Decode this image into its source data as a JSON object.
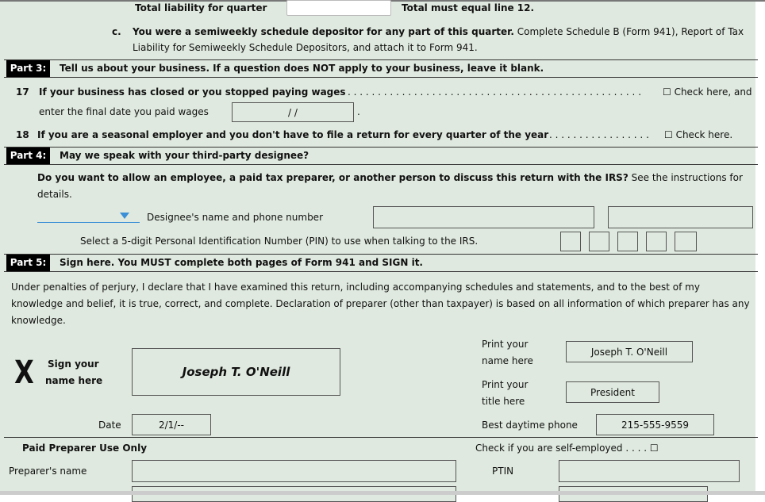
{
  "line16": {
    "total_label": "Total liability for quarter",
    "total_value": "",
    "total_note": "Total must equal line 12.",
    "c_letter": "c.",
    "c_bold": "You were a semiweekly schedule depositor for any part of this quarter.",
    "c_rest": "Complete Schedule B (Form 941), Report of Tax",
    "c_line2": "Liability for Semiweekly Schedule Depositors, and attach it to Form 941."
  },
  "part3": {
    "label": "Part 3:",
    "title": "Tell us about your business. If a question does NOT apply to your business, leave it blank.",
    "q17_num": "17",
    "q17_text": "If your business has closed or you stopped paying wages",
    "q17_dots": ". . . . . . . . . . . . . . . . . . . . . . . . . . . . . . . . . . . . . . . . . . . . . . . . .",
    "q17_check": "☐ Check here, and",
    "q17_line2": "enter the final date you paid wages",
    "q17_date": "/        /",
    "q17_period": ".",
    "q18_num": "18",
    "q18_text": "If you are a seasonal employer and you don't have to file a return for every quarter of the year",
    "q18_dots": ". . . . . . . . . . . . . . . . .",
    "q18_check": "☐ Check here."
  },
  "part4": {
    "label": "Part 4:",
    "title": "May we speak with your third-party designee?",
    "question_bold": "Do you want to allow an employee, a paid tax preparer, or another person to discuss this return with the IRS?",
    "question_rest": "See the instructions for",
    "question_line2": "details.",
    "dropdown_value": "",
    "designee_label": "Designee's name and phone number",
    "designee_name": "",
    "designee_phone": "",
    "pin_label": "Select a 5-digit Personal Identification Number (PIN) to use when talking to the IRS.",
    "pin_digits": [
      "",
      "",
      "",
      "",
      ""
    ]
  },
  "part5": {
    "label": "Part 5:",
    "title": "Sign here. You MUST complete both pages of Form 941 and SIGN it.",
    "declaration": [
      "Under penalties of perjury, I declare that I have examined this return, including accompanying schedules and statements, and to the best of my",
      "knowledge and belief, it is true, correct, and complete. Declaration of preparer (other than taxpayer) is based on all information of which preparer has any",
      "knowledge."
    ],
    "x_mark": "X",
    "sign_label_1": "Sign your",
    "sign_label_2": "name here",
    "signature": "Joseph T. O'Neill",
    "print_name_label_1": "Print your",
    "print_name_label_2": "name here",
    "print_name": "Joseph T. O'Neill",
    "print_title_label_1": "Print your",
    "print_title_label_2": "title here",
    "print_title": "President",
    "date_label": "Date",
    "date": "2/1/--",
    "phone_label": "Best daytime phone",
    "phone": "215-555-9559"
  },
  "preparer": {
    "heading": "Paid Preparer Use Only",
    "self_employed": "Check if you are self-employed . . . . ☐",
    "name_label": "Preparer's name",
    "name": "",
    "ptin_label": "PTIN",
    "ptin": ""
  },
  "colors": {
    "background": "#dfe9df",
    "dropdown_accent": "#3a8fd6",
    "part_label": "#000000"
  }
}
